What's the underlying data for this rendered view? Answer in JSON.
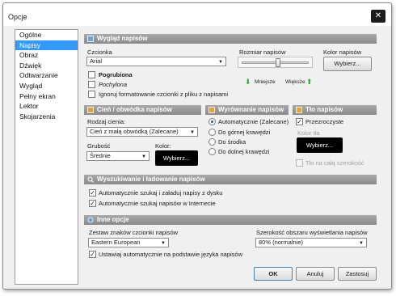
{
  "window": {
    "title": "Opcje",
    "close_glyph": "✕"
  },
  "sidebar": {
    "items": [
      "Ogólne",
      "Napisy",
      "Obraz",
      "Dźwięk",
      "Odtwarzanie",
      "Wygląd",
      "Pełny ekran",
      "Lektor",
      "Skojarzenia"
    ],
    "selected": "Napisy"
  },
  "appearance": {
    "header": "Wygląd napisów",
    "font_label": "Czcionka",
    "font_value": "Arial",
    "bold_label": "Pogrubiona",
    "italic_label": "Pochylona",
    "ignore_label": "Ignoruj formatowanie czcionki z pliku z napisami",
    "size_label": "Rozmiar napisów",
    "smaller_label": "Mniejsze",
    "larger_label": "Większe",
    "color_label": "Kolor napisów",
    "choose_label": "Wybierz..."
  },
  "shadow": {
    "header": "Cień / obwódka napisów",
    "type_label": "Rodzaj cienia:",
    "type_value": "Cień z małą obwódką (Zalecane)",
    "thickness_label": "Grubość",
    "thickness_value": "Średnie",
    "color_label": "Kolor:",
    "choose_label": "Wybierz..."
  },
  "alignment": {
    "header": "Wyrównanie napisów",
    "options": [
      "Automatycznie (Zalecane)",
      "Do górnej krawędzi",
      "Do środka",
      "Do dolnej krawędzi"
    ],
    "selected": "Automatycznie (Zalecane)"
  },
  "background": {
    "header": "Tło napisów",
    "transparent_label": "Przezroczyste",
    "color_label": "Kolor tła",
    "choose_label": "Wybierz...",
    "full_width_label": "Tło na całą szerokość"
  },
  "search": {
    "header": "Wyszukiwanie i ładowanie napisów",
    "auto_load_label": "Automatycznie szukaj i załaduj napisy z dysku",
    "auto_internet_label": "Automatycznie szukaj napisów w Internecie"
  },
  "other": {
    "header": "Inne opcje",
    "charset_label": "Zestaw znaków czcionki napisów",
    "charset_value": "Eastern European",
    "auto_set_label": "Ustawiaj automatycznie na podstawie języka napisów",
    "width_label": "Szerokość obszaru wyświetlania napisów",
    "width_value": "80% (normalnie)"
  },
  "buttons": {
    "ok": "OK",
    "cancel": "Anuluj",
    "apply": "Zastosuj"
  },
  "glyphs": {
    "check": "✓",
    "dropdown": "▼",
    "arrow_down": "⬇",
    "arrow_up": "⬆"
  },
  "colors": {
    "selection": "#3399ff",
    "section_header": "#959595",
    "arrow_green": "#3aa63a"
  }
}
